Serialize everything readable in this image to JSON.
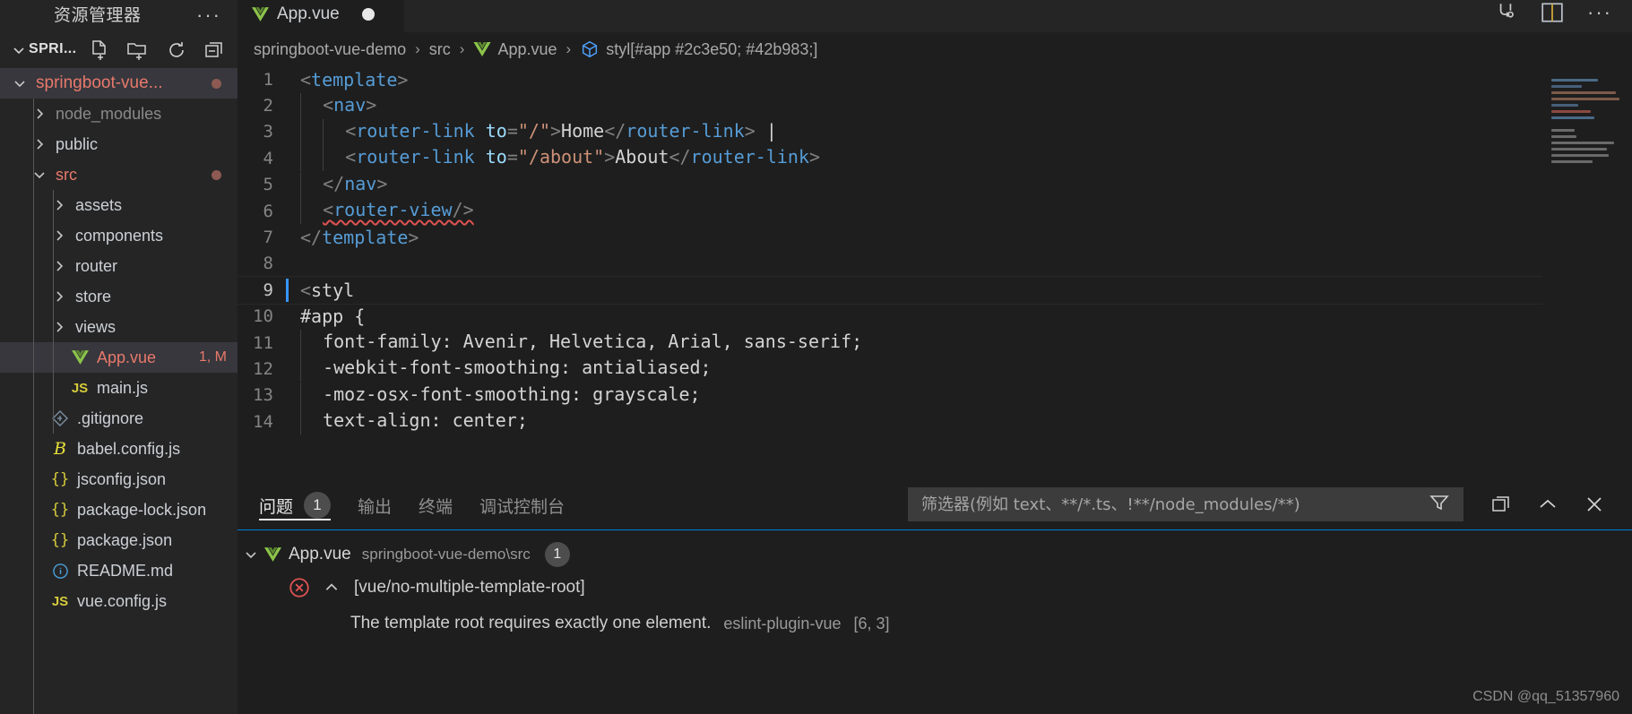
{
  "sidebar": {
    "title": "资源管理器",
    "more_label": "···",
    "explorer_section": "SPRI...",
    "header_actions": [
      {
        "name": "new-file-icon",
        "label": "新建文件"
      },
      {
        "name": "new-folder-icon",
        "label": "新建文件夹"
      },
      {
        "name": "refresh-icon",
        "label": "刷新资源管理器"
      },
      {
        "name": "collapse-all-icon",
        "label": "在资源管理器中折叠文件夹"
      }
    ],
    "tree": [
      {
        "label": "springboot-vue...",
        "type": "folder",
        "state": "expanded",
        "depth": 0,
        "modified": true,
        "selected": false,
        "root": true,
        "dot": true
      },
      {
        "label": "node_modules",
        "type": "folder",
        "state": "collapsed",
        "depth": 1,
        "dim": true
      },
      {
        "label": "public",
        "type": "folder",
        "state": "collapsed",
        "depth": 1
      },
      {
        "label": "src",
        "type": "folder",
        "state": "expanded",
        "depth": 1,
        "modified": true,
        "dot": true
      },
      {
        "label": "assets",
        "type": "folder",
        "state": "collapsed",
        "depth": 2
      },
      {
        "label": "components",
        "type": "folder",
        "state": "collapsed",
        "depth": 2
      },
      {
        "label": "router",
        "type": "folder",
        "state": "collapsed",
        "depth": 2
      },
      {
        "label": "store",
        "type": "folder",
        "state": "collapsed",
        "depth": 2
      },
      {
        "label": "views",
        "type": "folder",
        "state": "collapsed",
        "depth": 2
      },
      {
        "label": "App.vue",
        "type": "file",
        "icon": "vue-file-icon",
        "depth": 2,
        "selected": true,
        "modified": true,
        "badge": "1, M"
      },
      {
        "label": "main.js",
        "type": "file",
        "icon": "js-file-icon",
        "depth": 2
      },
      {
        "label": ".gitignore",
        "type": "file",
        "icon": "git-file-icon",
        "depth": 1
      },
      {
        "label": "babel.config.js",
        "type": "file",
        "icon": "babel-file-icon",
        "depth": 1
      },
      {
        "label": "jsconfig.json",
        "type": "file",
        "icon": "json-file-icon",
        "depth": 1
      },
      {
        "label": "package-lock.json",
        "type": "file",
        "icon": "json-file-icon",
        "depth": 1
      },
      {
        "label": "package.json",
        "type": "file",
        "icon": "json-file-icon",
        "depth": 1
      },
      {
        "label": "README.md",
        "type": "file",
        "icon": "info-file-icon",
        "depth": 1
      },
      {
        "label": "vue.config.js",
        "type": "file",
        "icon": "js-file-icon",
        "depth": 1
      }
    ]
  },
  "tabs": {
    "open": [
      {
        "label": "App.vue",
        "icon": "vue-file-icon",
        "dirty": true,
        "active": true
      }
    ],
    "actions": [
      {
        "name": "split-editor-icon",
        "label": "拆分编辑器"
      },
      {
        "name": "open-changes-icon",
        "label": "打开更改"
      },
      {
        "name": "more-actions-icon",
        "label": "···"
      }
    ]
  },
  "breadcrumb": {
    "items": [
      {
        "label": "springboot-vue-demo",
        "icon": null
      },
      {
        "label": "src",
        "icon": null
      },
      {
        "label": "App.vue",
        "icon": "vue-file-icon"
      },
      {
        "label": "styl[#app #2c3e50; #42b983;]",
        "icon": "symbol-namespace-icon"
      }
    ],
    "separator": "›"
  },
  "editor": {
    "active_line": 9,
    "lines": [
      {
        "n": 1,
        "indent": 0,
        "tokens": [
          {
            "t": "punct",
            "v": "<"
          },
          {
            "t": "tag",
            "v": "template"
          },
          {
            "t": "punct",
            "v": ">"
          }
        ]
      },
      {
        "n": 2,
        "indent": 1,
        "tokens": [
          {
            "t": "punct",
            "v": "<"
          },
          {
            "t": "tag",
            "v": "nav"
          },
          {
            "t": "punct",
            "v": ">"
          }
        ]
      },
      {
        "n": 3,
        "indent": 2,
        "tokens": [
          {
            "t": "punct",
            "v": "<"
          },
          {
            "t": "tag",
            "v": "router-link"
          },
          {
            "t": "attr",
            "v": " to"
          },
          {
            "t": "punct",
            "v": "="
          },
          {
            "t": "str",
            "v": "\"/\""
          },
          {
            "t": "punct",
            "v": ">"
          },
          {
            "t": "txt",
            "v": "Home"
          },
          {
            "t": "punct",
            "v": "</"
          },
          {
            "t": "tag",
            "v": "router-link"
          },
          {
            "t": "punct",
            "v": ">"
          },
          {
            "t": "txt",
            "v": " |"
          }
        ]
      },
      {
        "n": 4,
        "indent": 2,
        "tokens": [
          {
            "t": "punct",
            "v": "<"
          },
          {
            "t": "tag",
            "v": "router-link"
          },
          {
            "t": "attr",
            "v": " to"
          },
          {
            "t": "punct",
            "v": "="
          },
          {
            "t": "str",
            "v": "\"/about\""
          },
          {
            "t": "punct",
            "v": ">"
          },
          {
            "t": "txt",
            "v": "About"
          },
          {
            "t": "punct",
            "v": "</"
          },
          {
            "t": "tag",
            "v": "router-link"
          },
          {
            "t": "punct",
            "v": ">"
          }
        ]
      },
      {
        "n": 5,
        "indent": 1,
        "tokens": [
          {
            "t": "punct",
            "v": "</"
          },
          {
            "t": "tag",
            "v": "nav"
          },
          {
            "t": "punct",
            "v": ">"
          }
        ]
      },
      {
        "n": 6,
        "indent": 1,
        "error": true,
        "tokens": [
          {
            "t": "punct",
            "v": "<"
          },
          {
            "t": "tag",
            "v": "router-view"
          },
          {
            "t": "punct",
            "v": "/>"
          }
        ]
      },
      {
        "n": 7,
        "indent": 0,
        "tokens": [
          {
            "t": "punct",
            "v": "</"
          },
          {
            "t": "tag",
            "v": "template"
          },
          {
            "t": "punct",
            "v": ">"
          }
        ]
      },
      {
        "n": 8,
        "indent": 0,
        "tokens": []
      },
      {
        "n": 9,
        "indent": 0,
        "active": true,
        "tokens": [
          {
            "t": "punct",
            "v": "<"
          },
          {
            "t": "txt",
            "v": "styl"
          }
        ]
      },
      {
        "n": 10,
        "indent": 0,
        "tokens": [
          {
            "t": "txt",
            "v": "#app {"
          }
        ]
      },
      {
        "n": 11,
        "indent": 1,
        "tokens": [
          {
            "t": "txt",
            "v": "font-family: Avenir, Helvetica, Arial, sans-serif;"
          }
        ]
      },
      {
        "n": 12,
        "indent": 1,
        "tokens": [
          {
            "t": "txt",
            "v": "-webkit-font-smoothing: antialiased;"
          }
        ]
      },
      {
        "n": 13,
        "indent": 1,
        "tokens": [
          {
            "t": "txt",
            "v": "-moz-osx-font-smoothing: grayscale;"
          }
        ]
      },
      {
        "n": 14,
        "indent": 1,
        "tokens": [
          {
            "t": "txt",
            "v": "text-align: center;"
          }
        ]
      }
    ]
  },
  "panel": {
    "tabs": [
      {
        "label": "问题",
        "active": true,
        "count": "1"
      },
      {
        "label": "输出",
        "active": false
      },
      {
        "label": "终端",
        "active": false
      },
      {
        "label": "调试控制台",
        "active": false
      }
    ],
    "filter": {
      "value": "",
      "placeholder": "筛选器(例如 text、**/*.ts、!**/node_modules/**)",
      "icon": "filter-icon"
    },
    "actions": [
      {
        "name": "split-panel-icon",
        "label": "在编辑器区域中打开"
      },
      {
        "name": "chevron-up-icon",
        "label": "最大化面板大小"
      },
      {
        "name": "close-icon",
        "label": "关闭面板"
      }
    ],
    "problems": {
      "file": "App.vue",
      "file_icon": "vue-file-icon",
      "path": "springboot-vue-demo\\src",
      "count": "1",
      "rule": "[vue/no-multiple-template-root]",
      "severity_icon": "error-icon",
      "message": "The template root requires exactly one element.",
      "source": "eslint-plugin-vue",
      "position": "[6, 3]"
    }
  },
  "watermark": "CSDN @qq_51357960",
  "colors": {
    "accent": "#007fd4",
    "modified": "#e8796b",
    "error": "#e05252",
    "vue_green": "#8bc34a",
    "tag_blue": "#569cd6",
    "string_orange": "#ce9178",
    "attr_blue": "#9cdcfe"
  }
}
